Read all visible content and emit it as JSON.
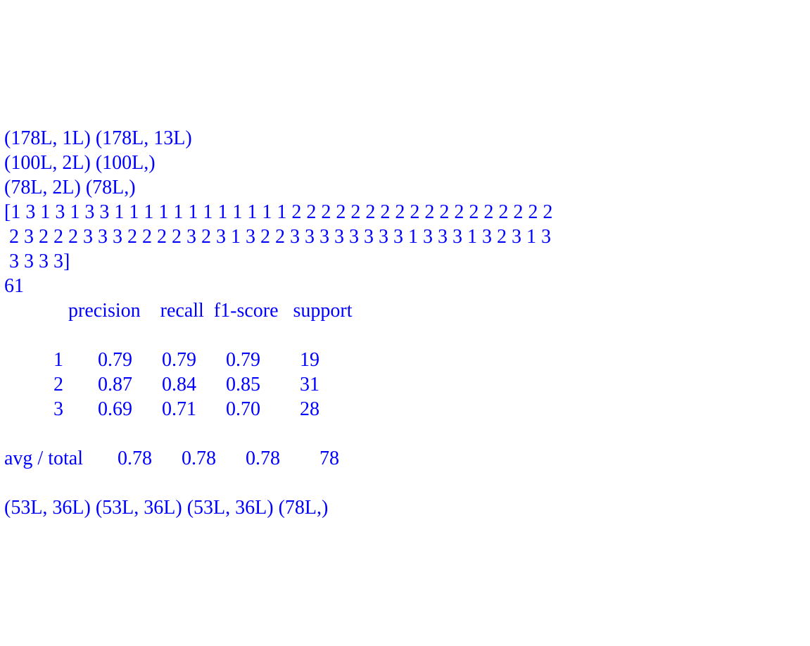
{
  "output": {
    "lines": [
      "(178L, 1L) (178L, 13L)",
      "(100L, 2L) (100L,)",
      "(78L, 2L) (78L,)",
      "[1 3 1 3 1 3 3 1 1 1 1 1 1 1 1 1 1 1 1 2 2 2 2 2 2 2 2 2 2 2 2 2 2 2 2 2 2",
      " 2 3 2 2 2 3 3 3 2 2 2 2 3 2 3 1 3 2 2 3 3 3 3 3 3 3 3 1 3 3 3 1 3 2 3 1 3",
      " 3 3 3 3]",
      "61",
      "             precision    recall  f1-score   support",
      "",
      "          1       0.79      0.79      0.79        19",
      "          2       0.87      0.84      0.85        31",
      "          3       0.69      0.71      0.70        28",
      "",
      "avg / total       0.78      0.78      0.78        78",
      "",
      "(53L, 36L) (53L, 36L) (53L, 36L) (78L,)"
    ]
  },
  "shapes": {
    "dataset_full": "(178L, 1L) (178L, 13L)",
    "train": "(100L, 2L) (100L,)",
    "test": "(78L, 2L) (78L,)",
    "final_tuple": "(53L, 36L) (53L, 36L) (53L, 36L) (78L,)"
  },
  "predictions_array": "[1 3 1 3 1 3 3 1 1 1 1 1 1 1 1 1 1 1 1 2 2 2 2 2 2 2 2 2 2 2 2 2 2 2 2 2 2 2 3 2 2 2 3 3 3 2 2 2 2 3 2 3 1 3 2 2 3 3 3 3 3 3 3 3 1 3 3 3 1 3 2 3 1 3 3 3 3 3]",
  "correct_count": "61",
  "classification_report": {
    "columns": [
      "precision",
      "recall",
      "f1-score",
      "support"
    ],
    "classes": [
      {
        "label": "1",
        "precision": "0.79",
        "recall": "0.79",
        "f1": "0.79",
        "support": "19"
      },
      {
        "label": "2",
        "precision": "0.87",
        "recall": "0.84",
        "f1": "0.85",
        "support": "31"
      },
      {
        "label": "3",
        "precision": "0.69",
        "recall": "0.71",
        "f1": "0.70",
        "support": "28"
      }
    ],
    "avg_total": {
      "label": "avg / total",
      "precision": "0.78",
      "recall": "0.78",
      "f1": "0.78",
      "support": "78"
    }
  }
}
